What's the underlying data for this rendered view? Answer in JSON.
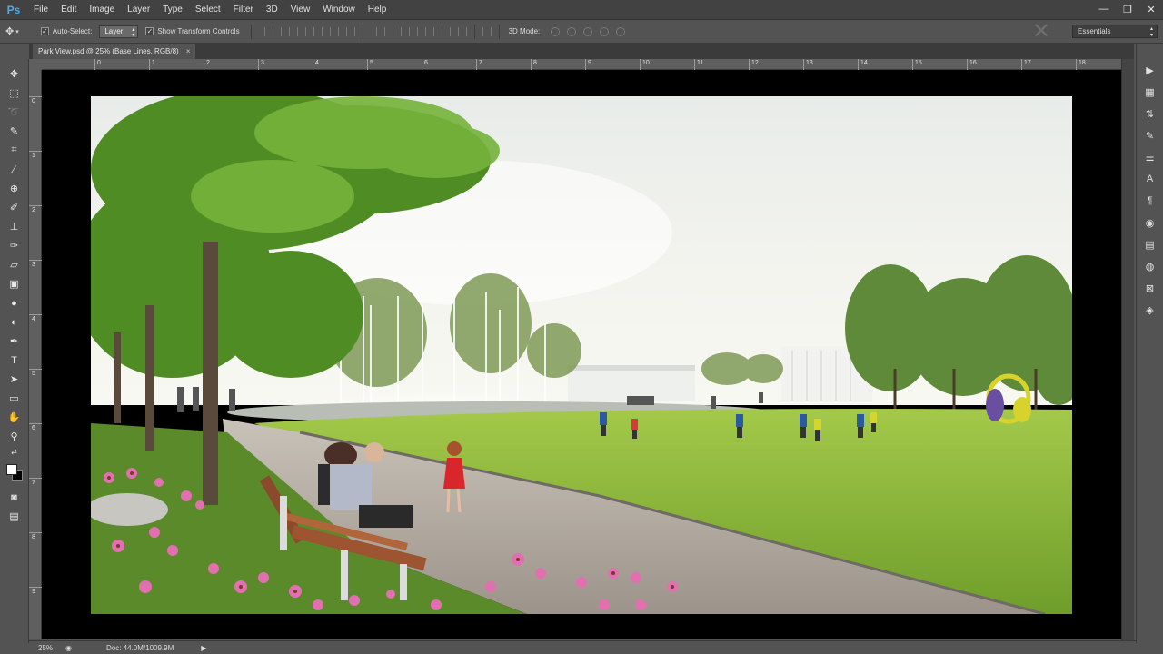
{
  "app": {
    "logo": "Ps",
    "menu": [
      "File",
      "Edit",
      "Image",
      "Layer",
      "Type",
      "Select",
      "Filter",
      "3D",
      "View",
      "Window",
      "Help"
    ],
    "window_controls": [
      "—",
      "❐",
      "✕"
    ]
  },
  "options": {
    "auto_select_label": "Auto-Select:",
    "auto_select_value": "Layer",
    "show_transform_label": "Show Transform Controls",
    "mode_label": "3D Mode:",
    "workspace": "Essentials"
  },
  "document": {
    "tab_title": "Park View.psd @ 25% (Base Lines, RGB/8)",
    "tab_close": "×"
  },
  "ruler_h": [
    "0",
    "1",
    "2",
    "3",
    "4",
    "5",
    "6",
    "7",
    "8",
    "9",
    "10",
    "11",
    "12",
    "13",
    "14",
    "15",
    "16",
    "17",
    "18"
  ],
  "ruler_v": [
    "0",
    "1",
    "2",
    "3",
    "4",
    "5",
    "6",
    "7",
    "8",
    "9"
  ],
  "status": {
    "zoom": "25%",
    "doc_info": "Doc: 44.0M/1009.9M",
    "arrow": "▶"
  },
  "colors": {
    "foreground": "#ffffff",
    "background": "#000000"
  }
}
